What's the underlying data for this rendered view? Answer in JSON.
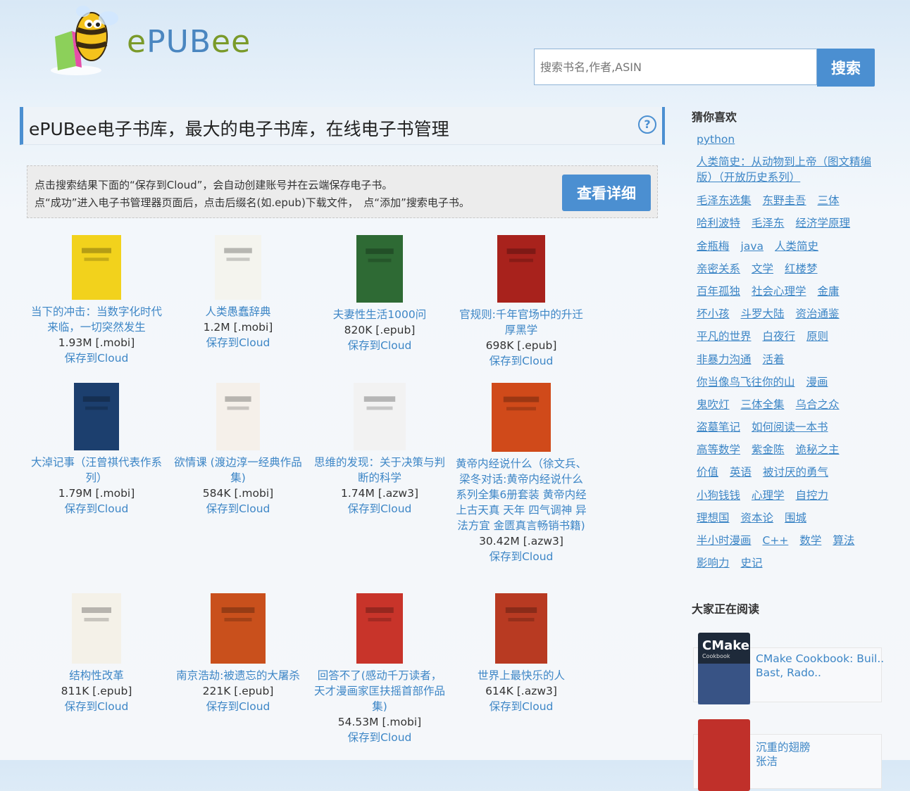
{
  "header": {
    "logo_text_e": "e",
    "logo_text_pub": "PUB",
    "logo_text_ee": "ee",
    "search_placeholder": "搜索书名,作者,ASIN",
    "search_button": "搜索"
  },
  "main": {
    "title": "ePUBee电子书库，最大的电子书库，在线电子书管理",
    "help": "?",
    "notice_line1": "点击搜索结果下面的“保存到Cloud”，会自动创建账号并在云端保存电子书。",
    "notice_line2": "点“成功”进入电子书管理器页面后，点击后缀名(如.epub)下载文件，　点“添加”搜索电子书。",
    "detail_button": "查看详细"
  },
  "books": [
    {
      "title": "当下的冲击：当数字化时代来临，一切突然发生",
      "size": "1.93M [.mobi]",
      "save": "保存到Cloud",
      "cover_color": "#f2d21c"
    },
    {
      "title": "人类愚蠢辞典",
      "size": "1.2M [.mobi]",
      "save": "保存到Cloud",
      "cover_color": "#f4f4ee"
    },
    {
      "title": "夫妻性生活1000问",
      "size": "820K [.epub]",
      "save": "保存到Cloud",
      "cover_color": "#2e6a34"
    },
    {
      "title": "官规则:千年官场中的升迁厚黑学",
      "size": "698K [.epub]",
      "save": "保存到Cloud",
      "cover_color": "#a8221c"
    },
    {
      "title": "大淖记事（汪曾祺代表作系列）",
      "size": "1.79M [.mobi]",
      "save": "保存到Cloud",
      "cover_color": "#1c3f6e"
    },
    {
      "title": "欲情课 (渡边淳一经典作品集)",
      "size": "584K [.mobi]",
      "save": "保存到Cloud",
      "cover_color": "#f5f0ea"
    },
    {
      "title": "思维的发现：关于决策与判断的科学",
      "size": "1.74M [.azw3]",
      "save": "保存到Cloud",
      "cover_color": "#f2f2f2"
    },
    {
      "title": "黄帝内经说什么（徐文兵、梁冬对话:黄帝内经说什么系列全集6册套装 黄帝内经上古天真 天年 四气调神 异法方宜 金匮真言畅销书籍)",
      "size": "30.42M [.azw3]",
      "save": "保存到Cloud",
      "cover_color": "#d04a1a"
    },
    {
      "title": "结构性改革",
      "size": "811K [.epub]",
      "save": "保存到Cloud",
      "cover_color": "#f4f1e8"
    },
    {
      "title": "南京浩劫:被遗忘的大屠杀",
      "size": "221K [.epub]",
      "save": "保存到Cloud",
      "cover_color": "#c9501c"
    },
    {
      "title": "回答不了(感动千万读者，天才漫画家匡扶摇首部作品集)",
      "size": "54.53M [.mobi]",
      "save": "保存到Cloud",
      "cover_color": "#c8342a"
    },
    {
      "title": "世界上最快乐的人",
      "size": "614K [.azw3]",
      "save": "保存到Cloud",
      "cover_color": "#b83a22"
    }
  ],
  "sidebar": {
    "guess_heading": "猜你喜欢",
    "tag_rows": [
      [
        "python"
      ],
      [
        "人类简史：从动物到上帝（图文精编版）（开放历史系列）"
      ],
      [
        "毛泽东选集",
        "东野圭吾",
        "三体"
      ],
      [
        "哈利波特",
        "毛泽东",
        "经济学原理"
      ],
      [
        "金瓶梅",
        "java",
        "人类简史"
      ],
      [
        "亲密关系",
        "文学",
        "红楼梦"
      ],
      [
        "百年孤独",
        "社会心理学",
        "金庸"
      ],
      [
        "坏小孩",
        "斗罗大陆",
        "资治通鉴"
      ],
      [
        "平凡的世界",
        "白夜行",
        "原则"
      ],
      [
        "非暴力沟通",
        "活着"
      ],
      [
        "你当像鸟飞往你的山",
        "漫画"
      ],
      [
        "鬼吹灯",
        "三体全集",
        "乌合之众"
      ],
      [
        "盗墓笔记",
        "如何阅读一本书"
      ],
      [
        "高等数学",
        "紫金陈",
        "诡秘之主"
      ],
      [
        "价值",
        "英语",
        "被讨厌的勇气"
      ],
      [
        "小狗钱钱",
        "心理学",
        "自控力"
      ],
      [
        "理想国",
        "资本论",
        "围城"
      ],
      [
        "半小时漫画",
        "C++",
        "数学",
        "算法"
      ],
      [
        "影响力",
        "史记"
      ]
    ],
    "reading_heading": "大家正在阅读",
    "reading": [
      {
        "title": "CMake Cookbook: Buil..",
        "author": "Bast, Rado..",
        "thumb_text": "CMake",
        "thumb_sub": "Cookbook"
      },
      {
        "title": "沉重的翅膀",
        "author": "张洁",
        "thumb_text": "",
        "thumb_sub": ""
      }
    ]
  }
}
